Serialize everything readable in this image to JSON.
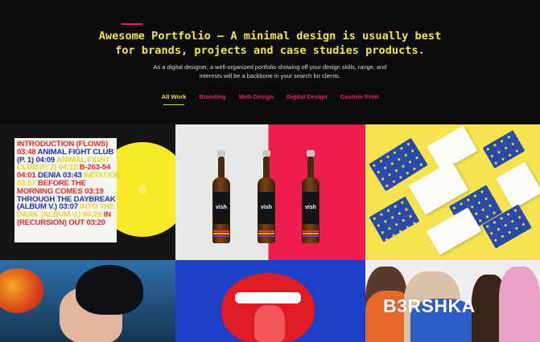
{
  "hero": {
    "headline_line1": "Awesome Portfolio — A minimal design is usually best",
    "headline_line2": "for brands, projects and case studies  products.",
    "subcopy_line1": "As a digital designer, a well-organized portfolio showing off your design skills, range, and",
    "subcopy_line2": "interests will be a backbone in your search for clients."
  },
  "filters": [
    {
      "label": "All Work",
      "active": true
    },
    {
      "label": "Branding",
      "active": false
    },
    {
      "label": "Web Design",
      "active": false
    },
    {
      "label": "Digital Design",
      "active": false
    },
    {
      "label": "Custom Print",
      "active": false
    }
  ],
  "portfolio": {
    "record": {
      "tracks": [
        {
          "text": "INTRODUCTION (FLOWS) ",
          "color": "red"
        },
        {
          "text": "03:48 ",
          "color": "red"
        },
        {
          "text": "ANIMAL FIGHT CLUB (P. 1) 04:09 ",
          "color": "blue"
        },
        {
          "text": "ANIMAL FIGHT CLUB (P. 2) 04:12 ",
          "color": "yellow"
        },
        {
          "text": "B-263-54 04:01 ",
          "color": "red"
        },
        {
          "text": "DENIA 03:43 ",
          "color": "blue"
        },
        {
          "text": "IMITATION 03:57 ",
          "color": "yellow"
        },
        {
          "text": "BEFORE THE MORNING COMES 03:19 ",
          "color": "red"
        },
        {
          "text": "THROUGH THE DAYBREAK (ALBUM V.) 03:07 ",
          "color": "blue"
        },
        {
          "text": "INTO THE DARK (ALBUM V.) 04:29 ",
          "color": "yellow"
        },
        {
          "text": "IN (RECURSION) OUT 03:20",
          "color": "red"
        }
      ]
    },
    "bottle_brand": "vish",
    "store_name": "B3RSHKA"
  },
  "colors": {
    "accent": "#e0245e",
    "headline": "#f2e34a",
    "active_filter": "#e7d44a"
  }
}
